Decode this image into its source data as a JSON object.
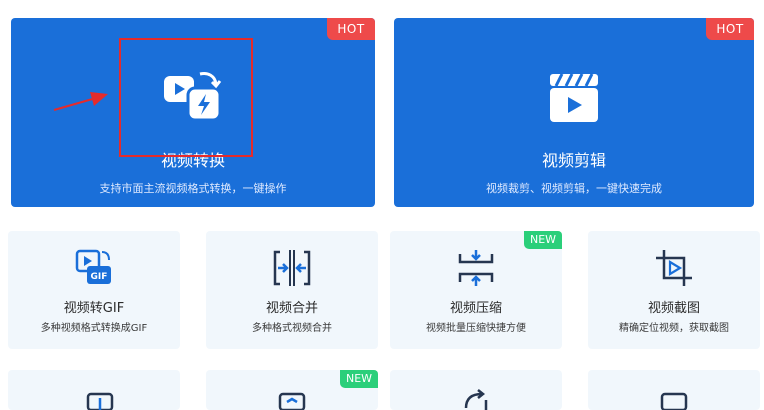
{
  "featured": [
    {
      "title": "视频转换",
      "desc": "支持市面主流视频格式转换，一键操作",
      "badge": "HOT",
      "icon": "video-convert-icon"
    },
    {
      "title": "视频剪辑",
      "desc": "视频裁剪、视频剪辑，一键快速完成",
      "badge": "HOT",
      "icon": "video-clip-icon"
    }
  ],
  "tools": [
    {
      "title": "视频转GIF",
      "desc": "多种视频格式转换成GIF",
      "badge": "",
      "icon": "video-to-gif-icon"
    },
    {
      "title": "视频合并",
      "desc": "多种格式视频合并",
      "badge": "",
      "icon": "merge-icon"
    },
    {
      "title": "视频压缩",
      "desc": "视频批量压缩快捷方便",
      "badge": "NEW",
      "icon": "compress-icon"
    },
    {
      "title": "视频截图",
      "desc": "精确定位视频，获取截图",
      "badge": "",
      "icon": "crop-icon"
    }
  ],
  "more_tools": [
    {
      "badge": ""
    },
    {
      "badge": "NEW"
    },
    {
      "badge": ""
    },
    {
      "badge": ""
    }
  ],
  "colors": {
    "primary": "#1a6fd9",
    "hot": "#ee4a4a",
    "new": "#2bcf7a",
    "card_bg": "#f1f7fc",
    "annotation": "#e52b2b"
  }
}
